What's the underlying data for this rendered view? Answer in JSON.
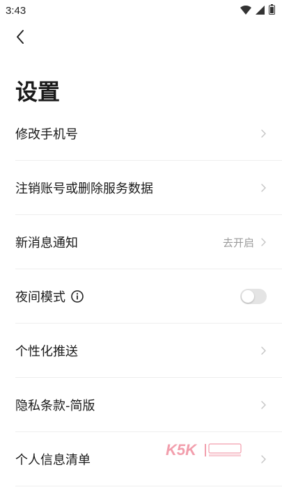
{
  "status_bar": {
    "time": "3:43",
    "icons": [
      "wifi-icon",
      "cellular-signal-icon",
      "battery-icon"
    ]
  },
  "nav": {
    "back_icon": "chevron-left-icon"
  },
  "page": {
    "title": "设置"
  },
  "settings": {
    "items": [
      {
        "label": "修改手机号",
        "value": "",
        "control": "chevron"
      },
      {
        "label": "注销账号或删除服务数据",
        "value": "",
        "control": "chevron"
      },
      {
        "label": "新消息通知",
        "value": "去开启",
        "control": "chevron"
      },
      {
        "label": "夜间模式",
        "value": "",
        "control": "toggle",
        "toggle_on": false,
        "has_info_icon": true
      },
      {
        "label": "个性化推送",
        "value": "",
        "control": "chevron"
      },
      {
        "label": "隐私条款-简版",
        "value": "",
        "control": "chevron"
      },
      {
        "label": "个人信息清单",
        "value": "",
        "control": "chevron"
      }
    ]
  },
  "watermark": {
    "text": "K5K",
    "accent_color": "#e8506a"
  },
  "colors": {
    "text_primary": "#1a1a1a",
    "text_secondary": "#9a9a9a",
    "divider": "#eeeeee",
    "toggle_off": "#e4e4e4"
  }
}
